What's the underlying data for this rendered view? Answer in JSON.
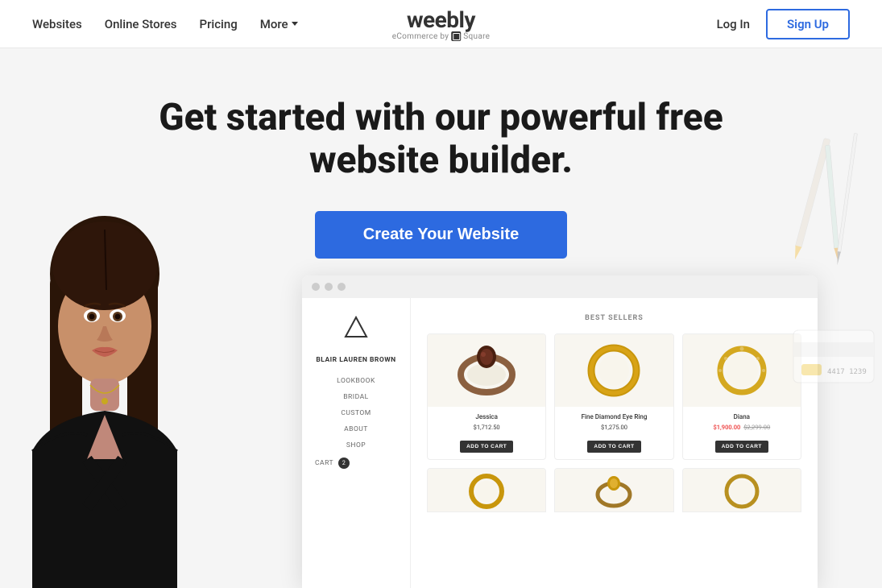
{
  "header": {
    "nav": {
      "websites": "Websites",
      "online_stores": "Online Stores",
      "pricing": "Pricing",
      "more": "More"
    },
    "logo": {
      "brand": "weebly",
      "sub": "eCommerce by",
      "by": "Square"
    },
    "auth": {
      "login": "Log In",
      "signup": "Sign Up"
    }
  },
  "hero": {
    "title": "Get started with our powerful free website builder.",
    "cta": "Create Your Website"
  },
  "mockup": {
    "sidebar": {
      "brand": "BLAIR LAUREN BROWN",
      "nav": [
        "LOOKBOOK",
        "BRIDAL",
        "CUSTOM",
        "ABOUT",
        "SHOP"
      ],
      "cart": "CART",
      "cart_count": "2"
    },
    "products": {
      "section_title": "BEST SELLERS",
      "items": [
        {
          "name": "Jessica",
          "price": "$1,712.50",
          "sale_price": null,
          "original_price": null,
          "btn": "ADD TO CART"
        },
        {
          "name": "Fine Diamond Eye Ring",
          "price": "$1,275.00",
          "sale_price": null,
          "original_price": null,
          "btn": "ADD TO CART"
        },
        {
          "name": "Diana",
          "price": null,
          "sale_price": "$1,900.00",
          "original_price": "$2,299.00",
          "btn": "ADD TO CART"
        }
      ]
    }
  }
}
